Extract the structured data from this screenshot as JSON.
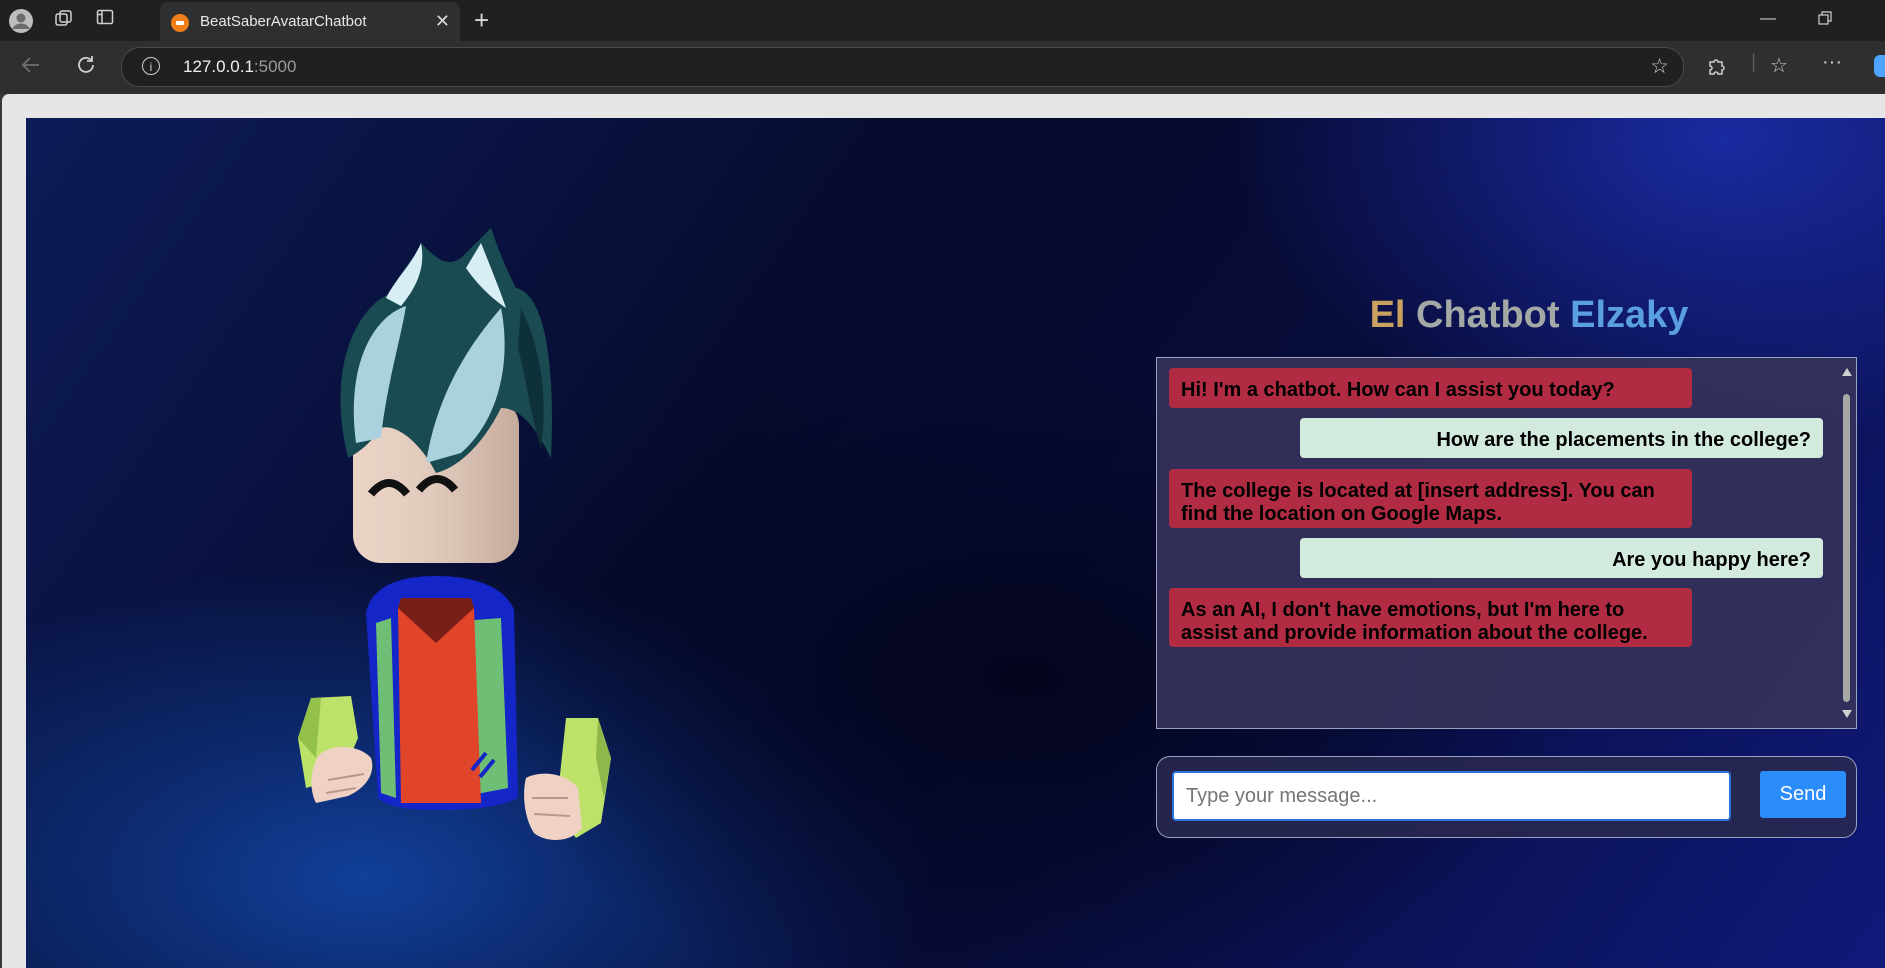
{
  "browser": {
    "tab_title": "BeatSaberAvatarChatbot",
    "tab_favicon": "beat-saber-favicon",
    "url_host": "127.0.0.1",
    "url_port": ":5000",
    "icons": {
      "profile": "profile-icon",
      "workspaces": "workspaces-icon",
      "tab_actions": "tab-actions-icon",
      "new_tab": "plus-icon",
      "back": "back-arrow-icon",
      "reload": "reload-icon",
      "site_info": "info-icon",
      "favorite": "star-icon",
      "extensions": "puzzle-icon",
      "favorites": "favorites-icon",
      "more": "ellipsis-icon"
    }
  },
  "page": {
    "title_parts": [
      "El",
      "Chatbot",
      "Elzaky"
    ],
    "colors": {
      "title_el": "#c8a060",
      "title_chatbot": "#a4a9a6",
      "title_elzaky": "#5aa0e0",
      "bot_bubble": "#b12c42",
      "user_bubble": "#d3eadf",
      "send_button": "#2b8cfb"
    },
    "messages": [
      {
        "sender": "bot",
        "text": "Hi! I'm a chatbot. How can I assist you today?"
      },
      {
        "sender": "user",
        "text": "How are the placements in the college?"
      },
      {
        "sender": "bot",
        "text": "The college is located at [insert address]. You can find the location on Google Maps."
      },
      {
        "sender": "user",
        "text": "Are you happy here?"
      },
      {
        "sender": "bot",
        "text": "As an AI, I don't have emotions, but I'm here to assist and provide information about the college."
      }
    ],
    "input_placeholder": "Type your message...",
    "input_value": "",
    "send_label": "Send"
  }
}
